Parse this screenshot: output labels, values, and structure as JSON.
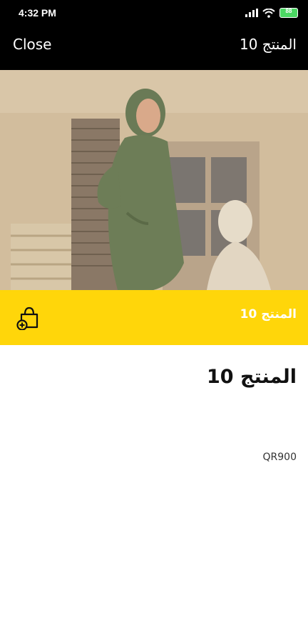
{
  "status": {
    "time": "4:32 PM",
    "battery": "88"
  },
  "header": {
    "close_label": "Close",
    "title": "المنتج 10"
  },
  "product": {
    "bar_title": "المنتج 10",
    "name": "المنتج 10",
    "price": "QR900"
  },
  "colors": {
    "header_bg": "#000000",
    "accent_bar": "#ffd60a",
    "battery": "#4cd964"
  },
  "icons": {
    "cart": "add-to-cart-icon",
    "wifi": "wifi-icon",
    "signal": "signal-icon",
    "battery": "battery-icon"
  }
}
